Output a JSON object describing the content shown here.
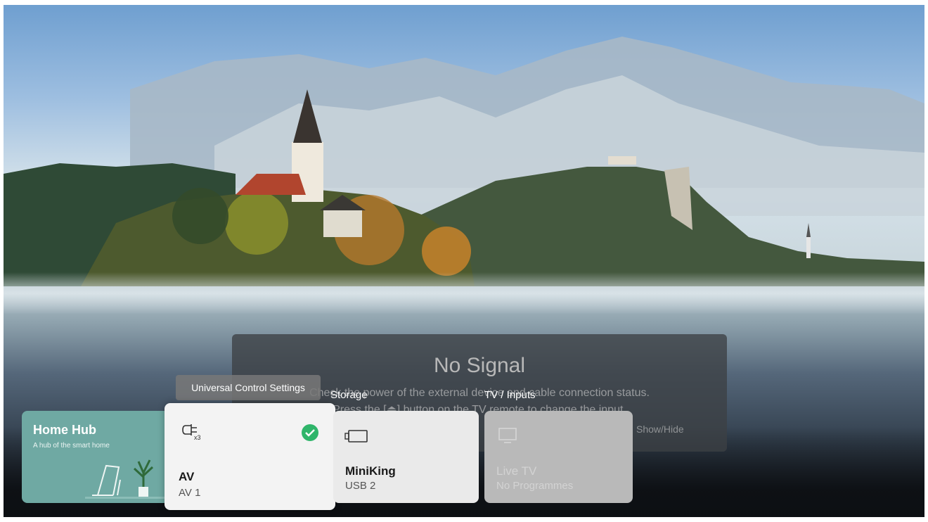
{
  "no_signal": {
    "title": "No Signal",
    "line1": "Check the power of the external device and cable connection status.",
    "line2": "Press the [⏏] button on the TV remote to change the input.",
    "show_hide": "Show/Hide"
  },
  "tooltip": "Universal Control Settings",
  "sections": {
    "storage": "Storage",
    "tv_inputs": "TV / Inputs"
  },
  "home_hub": {
    "title": "Home Hub",
    "subtitle": "A hub of the smart home"
  },
  "av_card": {
    "title": "AV",
    "subtitle": "AV 1",
    "icon_badge": "x3"
  },
  "usb_card": {
    "title": "MiniKing",
    "subtitle": "USB 2"
  },
  "live_card": {
    "title": "Live TV",
    "subtitle": "No Programmes"
  },
  "colors": {
    "check": "#2fb56a",
    "red_key": "#c4313b",
    "home_hub": "#6fa9a3"
  }
}
